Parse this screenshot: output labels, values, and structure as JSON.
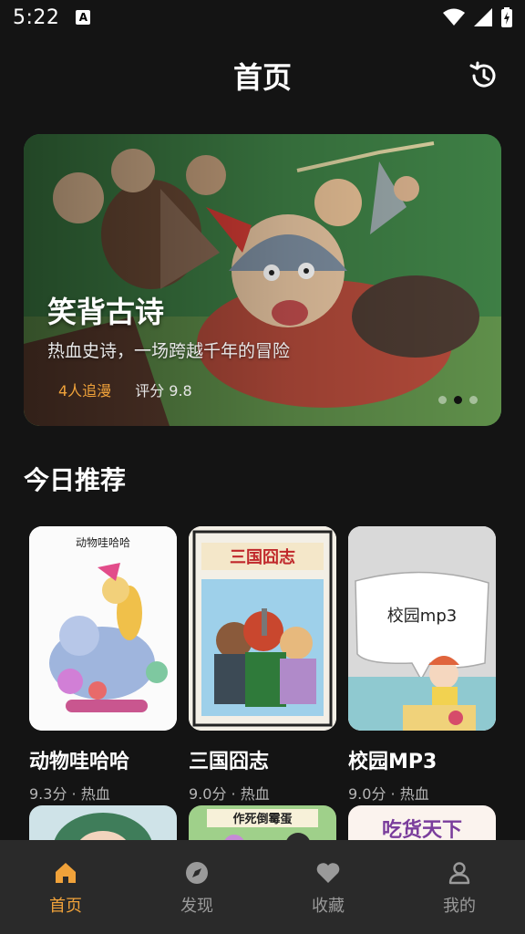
{
  "status_bar": {
    "time": "5:22",
    "notification_letter": "A"
  },
  "header": {
    "title": "首页"
  },
  "banner": {
    "title": "笑背古诗",
    "subtitle": "热血史诗，一场跨越千年的冒险",
    "fans": "4人追漫",
    "rating": "评分 9.8",
    "dots_total": 3,
    "active_dot_index": 1
  },
  "section": {
    "title": "今日推荐"
  },
  "cards": [
    {
      "cover_text": "动物哇哈哈",
      "title": "动物哇哈哈",
      "meta": "9.3分 · 热血"
    },
    {
      "cover_text": "三国囧志",
      "title": "三国囧志",
      "meta": "9.0分 · 热血"
    },
    {
      "cover_text": "校园mp3",
      "title": "校园MP3",
      "meta": "9.0分 · 热血"
    }
  ],
  "partial_cards": [
    {
      "cover_text": ""
    },
    {
      "cover_text": "作死倒霉蛋"
    },
    {
      "cover_text": "吃货天下"
    }
  ],
  "nav": [
    {
      "label": "首页",
      "icon": "home-icon",
      "active": true
    },
    {
      "label": "发现",
      "icon": "compass-icon",
      "active": false
    },
    {
      "label": "收藏",
      "icon": "heart-icon",
      "active": false
    },
    {
      "label": "我的",
      "icon": "user-icon",
      "active": false
    }
  ],
  "colors": {
    "accent": "#f0a23a",
    "background": "#141414",
    "nav_background": "#2a2a2a"
  }
}
